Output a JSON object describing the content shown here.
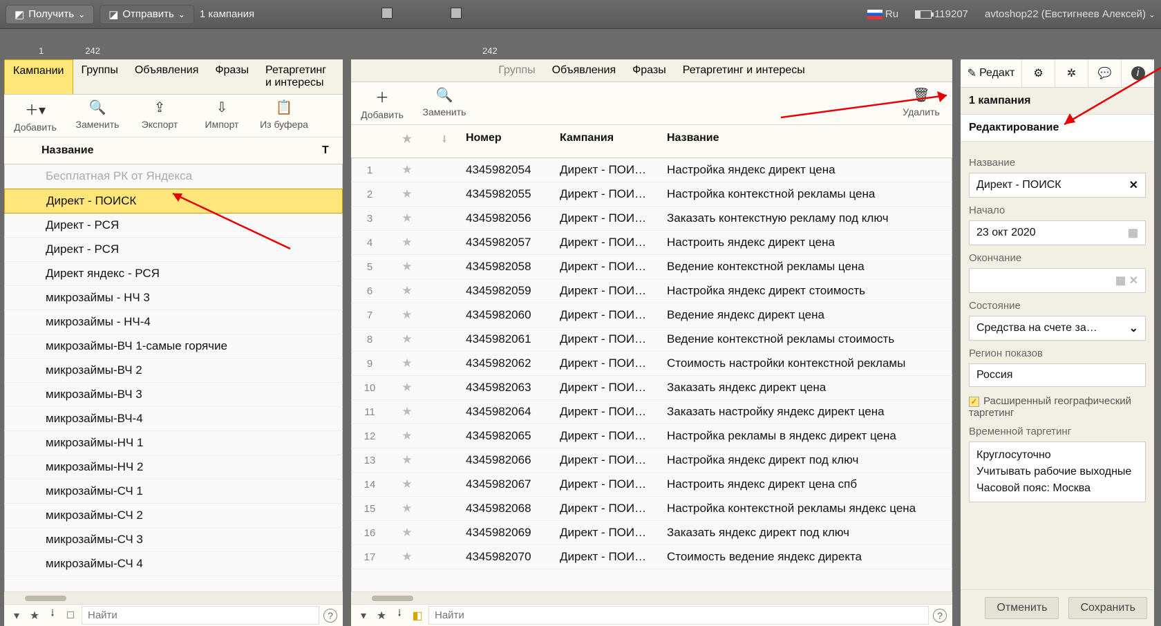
{
  "appbar": {
    "get": "Получить",
    "send": "Отправить",
    "campaign_count": "1 кампания",
    "lang": "Ru",
    "battery": "119207",
    "user": "avtoshop22 (Евстигнеев Алексей)"
  },
  "left": {
    "count1": "1",
    "count2": "242",
    "tabs": [
      "Кампании",
      "Группы",
      "Объявления",
      "Фразы",
      "Ретаргетинг и интересы"
    ],
    "tools": {
      "add": "Добавить",
      "replace": "Заменить",
      "export": "Экспорт",
      "import": "Импорт",
      "buffer": "Из буфера"
    },
    "header_name": "Название",
    "header_t": "Т",
    "rows": [
      {
        "name": "Бесплатная РК от Яндекса",
        "inactive": true
      },
      {
        "name": "Директ - ПОИСК",
        "selected": true
      },
      {
        "name": "Директ - РСЯ"
      },
      {
        "name": "Директ - РСЯ"
      },
      {
        "name": "Директ яндекс - РСЯ"
      },
      {
        "name": "микрозаймы - НЧ 3"
      },
      {
        "name": "микрозаймы - НЧ-4"
      },
      {
        "name": "микрозаймы-ВЧ 1-самые горячие"
      },
      {
        "name": "микрозаймы-ВЧ 2"
      },
      {
        "name": "микрозаймы-ВЧ 3"
      },
      {
        "name": "микрозаймы-ВЧ-4"
      },
      {
        "name": "микрозаймы-НЧ 1"
      },
      {
        "name": "микрозаймы-НЧ 2"
      },
      {
        "name": "микрозаймы-СЧ 1"
      },
      {
        "name": "микрозаймы-СЧ 2"
      },
      {
        "name": "микрозаймы-СЧ 3"
      },
      {
        "name": "микрозаймы-СЧ 4"
      }
    ],
    "search_placeholder": "Найти"
  },
  "mid": {
    "count": "242",
    "tabs": [
      "Группы",
      "Объявления",
      "Фразы",
      "Ретаргетинг и интересы"
    ],
    "tools": {
      "add": "Добавить",
      "replace": "Заменить",
      "delete": "Удалить"
    },
    "headers": {
      "num": "Номер",
      "camp": "Кампания",
      "name": "Название"
    },
    "rows": [
      {
        "n": "1",
        "num": "4345982054",
        "camp": "Директ - ПОИ…",
        "name": "Настройка яндекс директ цена"
      },
      {
        "n": "2",
        "num": "4345982055",
        "camp": "Директ - ПОИ…",
        "name": "Настройка контекстной рекламы цена"
      },
      {
        "n": "3",
        "num": "4345982056",
        "camp": "Директ - ПОИ…",
        "name": "Заказать контекстную рекламу под ключ"
      },
      {
        "n": "4",
        "num": "4345982057",
        "camp": "Директ - ПОИ…",
        "name": "Настроить яндекс директ цена"
      },
      {
        "n": "5",
        "num": "4345982058",
        "camp": "Директ - ПОИ…",
        "name": "Ведение контекстной рекламы цена"
      },
      {
        "n": "6",
        "num": "4345982059",
        "camp": "Директ - ПОИ…",
        "name": "Настройка яндекс директ стоимость"
      },
      {
        "n": "7",
        "num": "4345982060",
        "camp": "Директ - ПОИ…",
        "name": "Ведение яндекс директ цена"
      },
      {
        "n": "8",
        "num": "4345982061",
        "camp": "Директ - ПОИ…",
        "name": "Ведение контекстной рекламы стоимость"
      },
      {
        "n": "9",
        "num": "4345982062",
        "camp": "Директ - ПОИ…",
        "name": "Стоимость настройки контекстной рекламы"
      },
      {
        "n": "10",
        "num": "4345982063",
        "camp": "Директ - ПОИ…",
        "name": "Заказать яндекс директ цена"
      },
      {
        "n": "11",
        "num": "4345982064",
        "camp": "Директ - ПОИ…",
        "name": "Заказать настройку яндекс директ цена"
      },
      {
        "n": "12",
        "num": "4345982065",
        "camp": "Директ - ПОИ…",
        "name": "Настройка рекламы в яндекс директ цена"
      },
      {
        "n": "13",
        "num": "4345982066",
        "camp": "Директ - ПОИ…",
        "name": "Настройка яндекс директ под ключ"
      },
      {
        "n": "14",
        "num": "4345982067",
        "camp": "Директ - ПОИ…",
        "name": "Настроить яндекс директ цена спб"
      },
      {
        "n": "15",
        "num": "4345982068",
        "camp": "Директ - ПОИ…",
        "name": "Настройка контекстной рекламы яндекс цена"
      },
      {
        "n": "16",
        "num": "4345982069",
        "camp": "Директ - ПОИ…",
        "name": "Заказать яндекс директ под ключ"
      },
      {
        "n": "17",
        "num": "4345982070",
        "camp": "Директ - ПОИ…",
        "name": "Стоимость ведение яндекс директа"
      }
    ],
    "search_placeholder": "Найти"
  },
  "right": {
    "tab_edit": "Редакт",
    "h1": "1 кампания",
    "h2": "Редактирование",
    "f_name_lab": "Название",
    "f_name_val": "Директ - ПОИСК",
    "f_start_lab": "Начало",
    "f_start_val": "23 окт 2020",
    "f_end_lab": "Окончание",
    "f_end_val": "",
    "f_state_lab": "Состояние",
    "f_state_val": "Средства на счете за…",
    "f_region_lab": "Регион показов",
    "f_region_val": "Россия",
    "f_geo_chk": "Расширенный географический таргетинг",
    "f_time_lab": "Временной таргетинг",
    "f_time_l1": "Круглосуточно",
    "f_time_l2": "Учитывать рабочие выходные",
    "f_time_l3": "Часовой пояс: Москва",
    "btn_cancel": "Отменить",
    "btn_save": "Сохранить"
  }
}
